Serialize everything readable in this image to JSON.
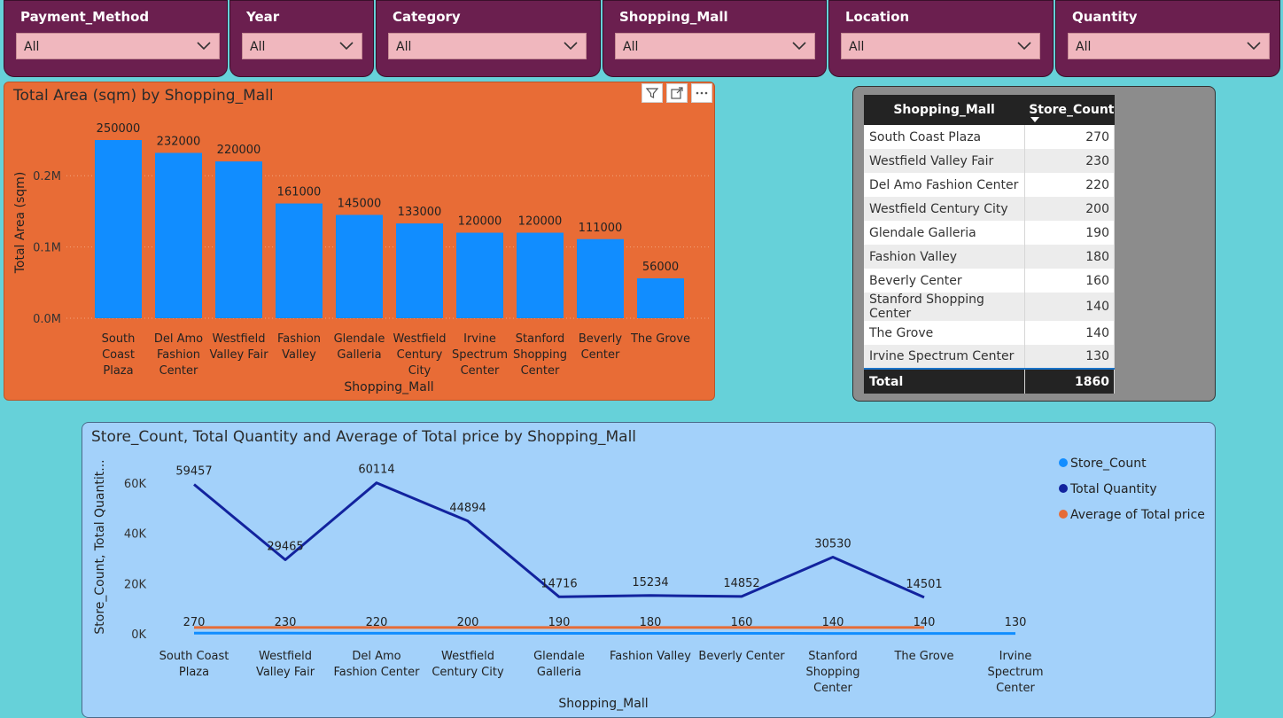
{
  "slicers": [
    {
      "title": "Payment_Method",
      "value": "All"
    },
    {
      "title": "Year",
      "value": "All"
    },
    {
      "title": "Category",
      "value": "All"
    },
    {
      "title": "Shopping_Mall",
      "value": "All"
    },
    {
      "title": "Location",
      "value": "All"
    },
    {
      "title": "Quantity",
      "value": "All"
    }
  ],
  "colors": {
    "background": "#66d1d9",
    "slicer": "#6b1f4f",
    "slicer_box": "#f0b7be",
    "bar_panel": "#e86c36",
    "bar": "#118dff",
    "line_panel": "#a3d1fa",
    "store_count": "#118dff",
    "total_quantity": "#12239e",
    "avg_total_price": "#e66c37"
  },
  "bar_chart": {
    "title": "Total Area (sqm) by Shopping_Mall",
    "icons": [
      "filter-icon",
      "focus-mode-icon",
      "more-options-icon"
    ]
  },
  "table": {
    "headers": [
      "Shopping_Mall",
      "Store_Count"
    ],
    "rows": [
      [
        "South Coast Plaza",
        "270"
      ],
      [
        "Westfield Valley Fair",
        "230"
      ],
      [
        "Del Amo Fashion Center",
        "220"
      ],
      [
        "Westfield Century City",
        "200"
      ],
      [
        "Glendale Galleria",
        "190"
      ],
      [
        "Fashion Valley",
        "180"
      ],
      [
        "Beverly Center",
        "160"
      ],
      [
        "Stanford Shopping Center",
        "140"
      ],
      [
        "The Grove",
        "140"
      ],
      [
        "Irvine Spectrum Center",
        "130"
      ]
    ],
    "total_label": "Total",
    "total_value": "1860"
  },
  "line_chart": {
    "title": "Store_Count, Total Quantity and Average of Total price by Shopping_Mall"
  },
  "chart_data": [
    {
      "type": "bar",
      "title": "Total Area (sqm) by Shopping_Mall",
      "xlabel": "Shopping_Mall",
      "ylabel": "Total Area (sqm)",
      "categories": [
        "South Coast Plaza",
        "Del Amo Fashion Center",
        "Westfield Valley Fair",
        "Fashion Valley",
        "Glendale Galleria",
        "Westfield Century City",
        "Irvine Spectrum Center",
        "Stanford Shopping Center",
        "Beverly Center",
        "The Grove"
      ],
      "category_labels": [
        [
          "South",
          "Coast",
          "Plaza"
        ],
        [
          "Del Amo",
          "Fashion",
          "Center"
        ],
        [
          "Westfield",
          "Valley Fair"
        ],
        [
          "Fashion",
          "Valley"
        ],
        [
          "Glendale",
          "Galleria"
        ],
        [
          "Westfield",
          "Century",
          "City"
        ],
        [
          "Irvine",
          "Spectrum",
          "Center"
        ],
        [
          "Stanford",
          "Shopping",
          "Center"
        ],
        [
          "Beverly",
          "Center"
        ],
        [
          "The Grove"
        ]
      ],
      "values": [
        250000,
        232000,
        220000,
        161000,
        145000,
        133000,
        120000,
        120000,
        111000,
        56000
      ],
      "yticks": [
        0,
        100000,
        200000
      ],
      "ytick_labels": [
        "0.0M",
        "0.1M",
        "0.2M"
      ],
      "ylim": [
        0,
        250000
      ],
      "grid": true
    },
    {
      "type": "line",
      "title": "Store_Count, Total Quantity and Average of Total price by Shopping_Mall",
      "xlabel": "Shopping_Mall",
      "ylabel": "Store_Count, Total Quantit...",
      "categories": [
        "South Coast Plaza",
        "Westfield Valley Fair",
        "Del Amo Fashion Center",
        "Westfield Century City",
        "Glendale Galleria",
        "Fashion Valley",
        "Beverly Center",
        "Stanford Shopping Center",
        "The Grove",
        "Irvine Spectrum Center"
      ],
      "category_labels": [
        [
          "South Coast",
          "Plaza"
        ],
        [
          "Westfield",
          "Valley Fair"
        ],
        [
          "Del Amo",
          "Fashion Center"
        ],
        [
          "Westfield",
          "Century City"
        ],
        [
          "Glendale",
          "Galleria"
        ],
        [
          "Fashion Valley"
        ],
        [
          "Beverly Center"
        ],
        [
          "Stanford",
          "Shopping",
          "Center"
        ],
        [
          "The Grove"
        ],
        [
          "Irvine",
          "Spectrum",
          "Center"
        ]
      ],
      "series": [
        {
          "name": "Store_Count",
          "values": [
            270,
            230,
            220,
            200,
            190,
            180,
            160,
            140,
            140,
            130
          ],
          "labeled": true
        },
        {
          "name": "Total Quantity",
          "values": [
            59457,
            29465,
            60114,
            44894,
            14716,
            15234,
            14852,
            30530,
            14501,
            null
          ],
          "labeled": true
        },
        {
          "name": "Average of Total price",
          "values": [
            2500,
            2500,
            2500,
            2500,
            2500,
            2500,
            2500,
            2500,
            2500,
            null
          ],
          "labeled": false
        }
      ],
      "yticks": [
        0,
        20000,
        40000,
        60000
      ],
      "ytick_labels": [
        "0K",
        "20K",
        "40K",
        "60K"
      ],
      "ylim": [
        0,
        60000
      ],
      "legend": "right"
    }
  ]
}
